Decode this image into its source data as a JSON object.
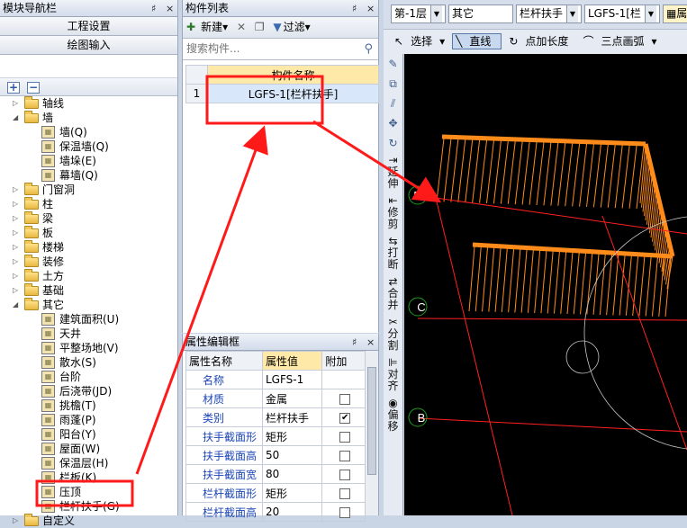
{
  "nav": {
    "title": "模块导航栏",
    "pin": "♯",
    "close": "×",
    "btn_project": "工程设置",
    "btn_draw": "绘图输入",
    "tree": [
      {
        "label": "轴线",
        "kind": "folder",
        "expander": "▷"
      },
      {
        "label": "墙",
        "kind": "folder",
        "expander": "◢"
      },
      {
        "label": "墙(Q)",
        "kind": "item",
        "icon": "wall-icon"
      },
      {
        "label": "保温墙(Q)",
        "kind": "item",
        "icon": "insulated-wall-icon"
      },
      {
        "label": "墙垛(E)",
        "kind": "item",
        "icon": "wall-pier-icon"
      },
      {
        "label": "幕墙(Q)",
        "kind": "item",
        "icon": "curtain-wall-icon"
      },
      {
        "label": "门窗洞",
        "kind": "folder",
        "expander": "▷"
      },
      {
        "label": "柱",
        "kind": "folder",
        "expander": "▷"
      },
      {
        "label": "梁",
        "kind": "folder",
        "expander": "▷"
      },
      {
        "label": "板",
        "kind": "folder",
        "expander": "▷"
      },
      {
        "label": "楼梯",
        "kind": "folder",
        "expander": "▷"
      },
      {
        "label": "装修",
        "kind": "folder",
        "expander": "▷"
      },
      {
        "label": "土方",
        "kind": "folder",
        "expander": "▷"
      },
      {
        "label": "基础",
        "kind": "folder",
        "expander": "▷"
      },
      {
        "label": "其它",
        "kind": "folder",
        "expander": "◢"
      },
      {
        "label": "建筑面积(U)",
        "kind": "item",
        "icon": "building-area-icon"
      },
      {
        "label": "天井",
        "kind": "item",
        "icon": "atrium-icon"
      },
      {
        "label": "平整场地(V)",
        "kind": "item",
        "icon": "site-leveling-icon"
      },
      {
        "label": "散水(S)",
        "kind": "item",
        "icon": "apron-icon"
      },
      {
        "label": "台阶",
        "kind": "item",
        "icon": "steps-icon"
      },
      {
        "label": "后浇带(JD)",
        "kind": "item",
        "icon": "post-pour-strip-icon"
      },
      {
        "label": "挑檐(T)",
        "kind": "item",
        "icon": "cornice-icon"
      },
      {
        "label": "雨蓬(P)",
        "kind": "item",
        "icon": "canopy-icon"
      },
      {
        "label": "阳台(Y)",
        "kind": "item",
        "icon": "balcony-icon"
      },
      {
        "label": "屋面(W)",
        "kind": "item",
        "icon": "roof-icon"
      },
      {
        "label": "保温层(H)",
        "kind": "item",
        "icon": "insulation-layer-icon"
      },
      {
        "label": "栏板(K)",
        "kind": "item",
        "icon": "parapet-panel-icon"
      },
      {
        "label": "压顶",
        "kind": "item",
        "icon": "coping-icon"
      },
      {
        "label": "栏杆扶手(G)",
        "kind": "item",
        "icon": "railing-icon",
        "selected": true
      },
      {
        "label": "自定义",
        "kind": "folder",
        "expander": "▷"
      }
    ]
  },
  "comp": {
    "title": "构件列表",
    "new_label": "新建",
    "filter_label": "过滤",
    "search_placeholder": "搜索构件...",
    "col_name": "构件名称",
    "rows": [
      {
        "num": "1",
        "name": "LGFS-1[栏杆扶手]"
      }
    ]
  },
  "prop": {
    "title": "属性编辑框",
    "col_name": "属性名称",
    "col_value": "属性值",
    "col_extra": "附加",
    "rows": [
      {
        "name": "名称",
        "value": "LGFS-1",
        "checkbox": false,
        "checked": false
      },
      {
        "name": "材质",
        "value": "金属",
        "checkbox": true,
        "checked": false
      },
      {
        "name": "类别",
        "value": "栏杆扶手",
        "checkbox": true,
        "checked": true
      },
      {
        "name": "扶手截面形",
        "value": "矩形",
        "checkbox": true,
        "checked": false
      },
      {
        "name": "扶手截面高",
        "value": "50",
        "checkbox": true,
        "checked": false
      },
      {
        "name": "扶手截面宽",
        "value": "80",
        "checkbox": true,
        "checked": false
      },
      {
        "name": "栏杆截面形",
        "value": "矩形",
        "checkbox": true,
        "checked": false
      },
      {
        "name": "栏杆截面高",
        "value": "20",
        "checkbox": true,
        "checked": false
      }
    ]
  },
  "cad": {
    "floor": "第-1层",
    "category": "其它",
    "type": "栏杆扶手",
    "component": "LGFS-1[栏",
    "props_btn": "属性",
    "select": "选择",
    "line": "直线",
    "point_length": "点加长度",
    "arc": "三点画弧",
    "grid_labels": [
      "D",
      "C",
      "B"
    ],
    "vtools": [
      "延伸",
      "修剪",
      "打断",
      "合并",
      "分割",
      "对齐",
      "偏移"
    ],
    "colors": {
      "railing": "#ff8c1a",
      "grid_line": "#ff2020",
      "axis_circle": "#1aa01a",
      "arrow": "#ff1a1a"
    }
  }
}
